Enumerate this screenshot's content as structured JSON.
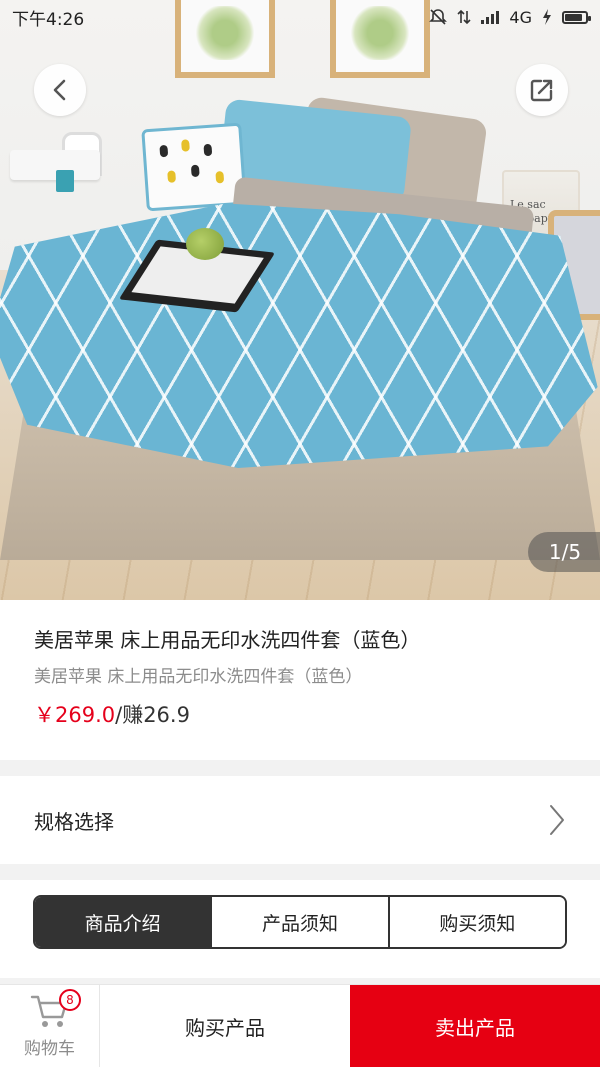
{
  "status_bar": {
    "time": "下午4:26",
    "network": "4G",
    "icons": [
      "dnd-icon",
      "data-transfer-icon",
      "signal-icon",
      "charging-icon",
      "battery-icon"
    ],
    "battery_level": 0.85
  },
  "gallery": {
    "counter": "1/5",
    "image_description_icon": "bedding-product-photo"
  },
  "product": {
    "title": "美居苹果 床上用品无印水洗四件套（蓝色）",
    "subtitle": "美居苹果 床上用品无印水洗四件套（蓝色）",
    "price": "￥269.0",
    "earn": "/赚26.9"
  },
  "spec": {
    "label": "规格选择"
  },
  "tabs": [
    {
      "label": "商品介绍",
      "active": true
    },
    {
      "label": "产品须知",
      "active": false
    },
    {
      "label": "购买须知",
      "active": false
    }
  ],
  "bottom_bar": {
    "cart_label": "购物车",
    "cart_count": "8",
    "buy_label": "购买产品",
    "sell_label": "卖出产品"
  },
  "colors": {
    "accent_red": "#e60012",
    "price_red": "#e5001b",
    "tab_active_bg": "#333333"
  }
}
